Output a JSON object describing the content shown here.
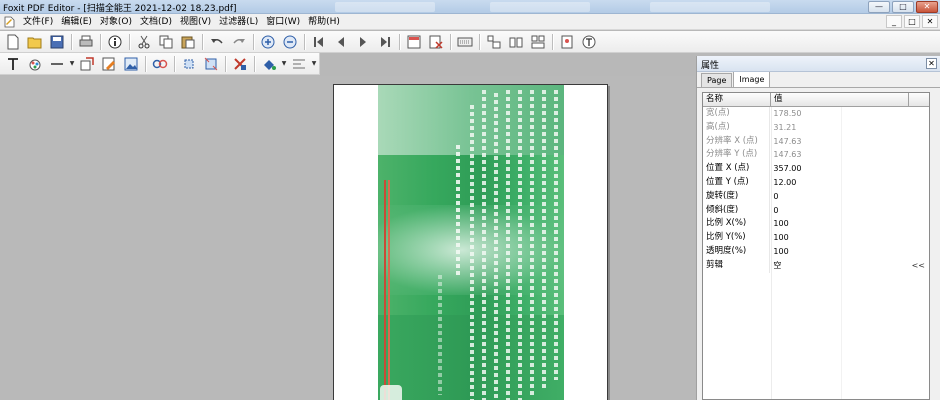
{
  "window": {
    "title": "Foxit PDF Editor - [扫描全能王 2021-12-02 18.23.pdf]",
    "buttons": [
      "—",
      "□",
      "✕"
    ]
  },
  "menubar": {
    "items": [
      "文件(F)",
      "编辑(E)",
      "对象(O)",
      "文档(D)",
      "视图(V)",
      "过滤器(L)",
      "窗口(W)",
      "帮助(H)"
    ],
    "right_buttons": [
      "_",
      "□",
      "✕"
    ]
  },
  "toolbar1": {
    "icons": [
      "new-icon",
      "open-icon",
      "save-icon",
      "print-icon",
      "info-icon",
      "cut-icon",
      "copy-icon",
      "paste-icon",
      "undo-icon",
      "redo-icon",
      "zoom-in-icon",
      "zoom-out-icon",
      "first-page-icon",
      "prev-page-icon",
      "next-page-icon",
      "last-page-icon",
      "insert-page-icon",
      "delete-page-icon",
      "keyboard-icon",
      "align-icon",
      "distribute-icon",
      "group-icon",
      "page-properties-icon",
      "text-mode-icon"
    ]
  },
  "toolbar2": {
    "icons": [
      "text-tool-icon",
      "color-tool-icon",
      "line-tool-icon",
      "shape-tool-icon",
      "edit-image-icon",
      "image-tool-icon",
      "link-tool-icon",
      "crop-icon",
      "resize-icon",
      "delete-object-icon",
      "fill-color-icon",
      "stroke-color-icon"
    ]
  },
  "panel": {
    "title": "属性",
    "tabs": [
      "Page",
      "Image"
    ],
    "active_tab": "Image",
    "columns": [
      "名称",
      "值"
    ],
    "rows": [
      {
        "name": "宽(点)",
        "value": "178.50",
        "readonly": true
      },
      {
        "name": "高(点)",
        "value": "31.21",
        "readonly": true
      },
      {
        "name": "分辨率 X (点)",
        "value": "147.63",
        "readonly": true
      },
      {
        "name": "分辨率 Y (点)",
        "value": "147.63",
        "readonly": true
      },
      {
        "name": "位置 X (点)",
        "value": "357.00",
        "readonly": false
      },
      {
        "name": "位置 Y (点)",
        "value": "12.00",
        "readonly": false
      },
      {
        "name": "旋转(度)",
        "value": "0",
        "readonly": false
      },
      {
        "name": "倾斜(度)",
        "value": "0",
        "readonly": false
      },
      {
        "name": "比例 X(%)",
        "value": "100",
        "readonly": false
      },
      {
        "name": "比例 Y(%)",
        "value": "100",
        "readonly": false
      },
      {
        "name": "透明度(%)",
        "value": "100",
        "readonly": false
      },
      {
        "name": "剪辑",
        "value": "空",
        "readonly": false,
        "button": "<<"
      }
    ]
  },
  "colors": {
    "scan_green": "#36a85d",
    "scan_stripe": "#c94b37",
    "workspace_gray": "#b9b9b9"
  }
}
